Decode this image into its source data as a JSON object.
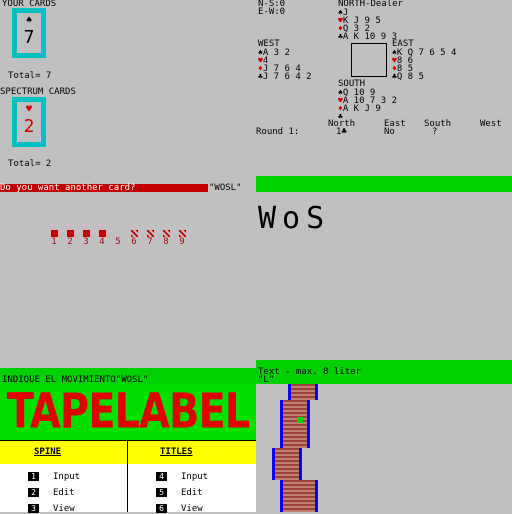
{
  "top_left": {
    "your_cards_label": "YOUR CARDS",
    "your_card": {
      "suit": "♠",
      "rank": "7"
    },
    "your_total": "Total= 7",
    "spectrum_cards_label": "SPECTRUM CARDS",
    "spectrum_card": {
      "suit": "♥",
      "rank": "2"
    },
    "spectrum_total": "Total= 2"
  },
  "bridge": {
    "ns_score": "N-S:0",
    "ew_score": "E-W:0",
    "north_label": "NORTH-Dealer",
    "north_hand": [
      "J",
      "K J 9 5",
      "Q 3 2",
      "A K 10 9 3"
    ],
    "west_label": "WEST",
    "west_hand": [
      "A 3 2",
      "4",
      "J 7 6 4",
      "J 7 6 4 2"
    ],
    "east_label": "EAST",
    "east_hand": [
      "K Q 7 6 5 4",
      "8 6",
      "8 5",
      "Q 8 5"
    ],
    "south_label": "SOUTH",
    "south_hand": [
      "Q 10 9",
      "A 10 7 3 2",
      "A K J 9",
      ""
    ],
    "round_label": "Round 1:",
    "round_bid": "1♣",
    "columns": [
      "North",
      "East",
      "South",
      "West"
    ],
    "bids": [
      "No",
      "?"
    ]
  },
  "blackjack_prompt": {
    "question": "Do you want another card?",
    "answer": "\"WOSL\""
  },
  "wos_panel": {
    "logo_text": "WoS",
    "digits": [
      "1",
      "2",
      "3",
      "4",
      "5",
      "6",
      "7",
      "8",
      "9"
    ]
  },
  "spanish_prompt": {
    "text": "INDIQUE EL MOVIMIENTO\"WOSL\""
  },
  "tapelabel": {
    "title": "TAPELABEL",
    "spine_header": "SPINE",
    "titles_header": "TITLES",
    "spine_items": [
      {
        "key": "1",
        "label": "Input"
      },
      {
        "key": "2",
        "label": "Edit"
      },
      {
        "key": "3",
        "label": "View"
      }
    ],
    "titles_items": [
      {
        "key": "4",
        "label": "Input"
      },
      {
        "key": "5",
        "label": "Edit"
      },
      {
        "key": "6",
        "label": "View"
      }
    ]
  },
  "text_panel": {
    "prompt": "Text - max. 8 liter",
    "input": "\"L\""
  },
  "colors": {
    "background": "#c0c0c0",
    "green": "#00d000",
    "red": "#c00000",
    "cyan": "#00c0c0",
    "yellow": "#ffff00",
    "blue": "#0000e0"
  }
}
